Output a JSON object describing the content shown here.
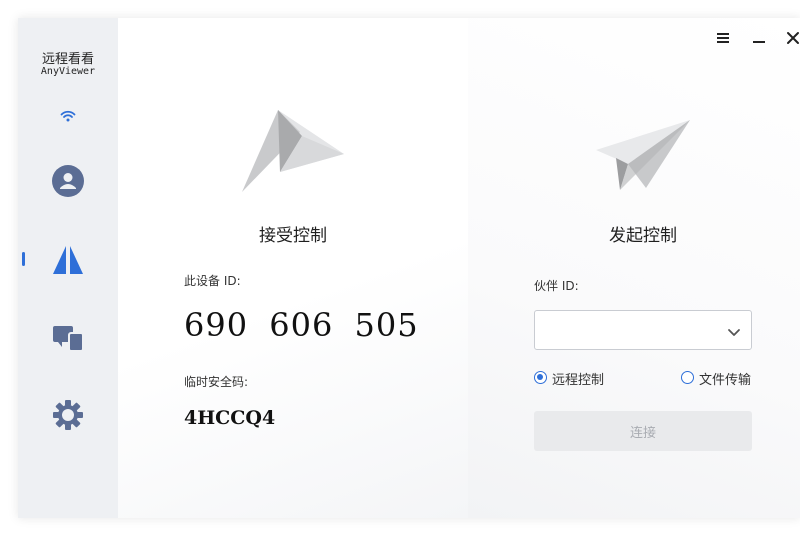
{
  "app": {
    "name_cn": "远程看看",
    "name_en": "AnyViewer"
  },
  "sidebar": {
    "items": [
      {
        "icon": "wifi-icon",
        "active": false
      },
      {
        "icon": "user-account-icon",
        "active": false
      },
      {
        "icon": "remote-control-icon",
        "active": true
      },
      {
        "icon": "device-list-icon",
        "active": false
      },
      {
        "icon": "settings-gear-icon",
        "active": false
      }
    ]
  },
  "window_controls": {
    "menu_icon": "hamburger-menu-icon",
    "minimize_icon": "minimize-icon",
    "close_icon": "close-icon"
  },
  "accept_control": {
    "title": "接受控制",
    "device_id_label": "此设备 ID:",
    "device_id": "690 606 505",
    "temp_code_label": "临时安全码:",
    "temp_code": "4HCCQ4"
  },
  "initiate_control": {
    "title": "发起控制",
    "partner_id_label": "伙伴 ID:",
    "partner_id_value": "",
    "partner_id_placeholder": "",
    "mode_options": [
      {
        "label": "远程控制",
        "checked": true
      },
      {
        "label": "文件传输",
        "checked": false
      }
    ],
    "connect_label": "连接",
    "connect_enabled": false
  },
  "colors": {
    "accent": "#2e6fd8",
    "sidebar_icon": "#5b6d94",
    "sidebar_bg": "#eef0f3"
  }
}
